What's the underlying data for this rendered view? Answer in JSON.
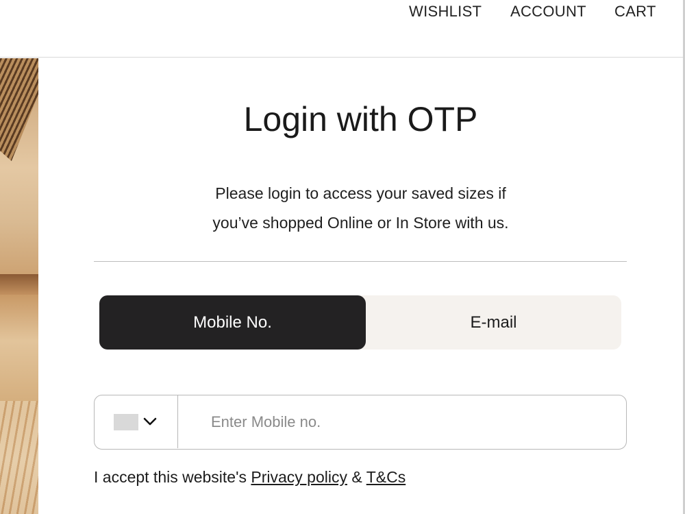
{
  "header": {
    "nav": {
      "wishlist": "WISHLIST",
      "account": "ACCOUNT",
      "cart": "CART"
    }
  },
  "login": {
    "title": "Login with OTP",
    "subtitle_line1": "Please login to access your saved sizes if",
    "subtitle_line2": "you’ve shopped Online or In Store with us.",
    "tabs": {
      "mobile": "Mobile No.",
      "email": "E-mail",
      "active": "Mobile No."
    },
    "phone": {
      "placeholder": "Enter Mobile no.",
      "value": ""
    },
    "consent": {
      "prefix": "I accept this website's ",
      "privacy": "Privacy policy",
      "amp": " & ",
      "terms": "T&Cs"
    }
  },
  "colors": {
    "active_tab_bg": "#232223",
    "inactive_tab_bg": "#f5f2ee",
    "input_border": "#b7b7b7"
  },
  "icons": {
    "country_flag": "flag-placeholder-icon",
    "dropdown": "chevron-down-icon"
  }
}
